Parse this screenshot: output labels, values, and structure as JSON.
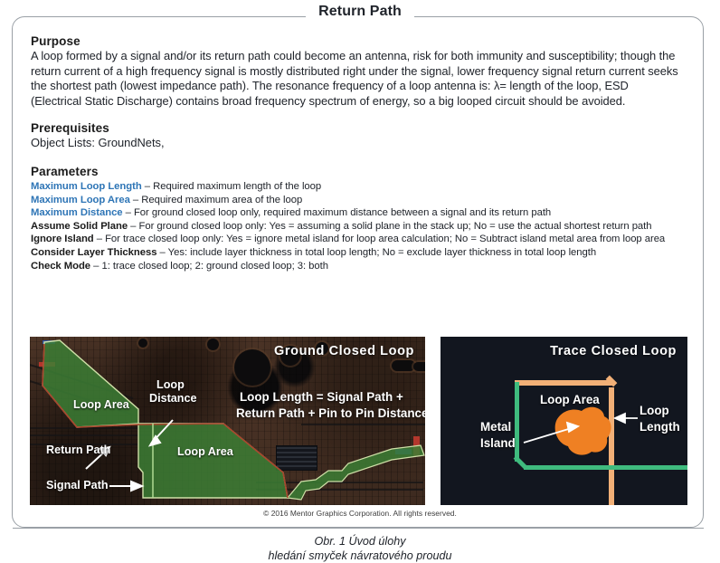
{
  "frame": {
    "title": "Return Path"
  },
  "purpose": {
    "heading": "Purpose",
    "text": "A loop formed by a signal and/or its return path could become an antenna, risk for both immunity and susceptibility; though the return current of a high frequency signal is mostly distributed right under the signal, lower frequency signal return current seeks the shortest path (lowest impedance path). The resonance frequency of a loop antenna is: λ= length of the loop, ESD (Electrical Static Discharge) contains broad frequency spectrum of energy, so a big looped circuit should be avoided."
  },
  "prerequisites": {
    "heading": "Prerequisites",
    "text": "Object Lists: GroundNets,"
  },
  "parameters": {
    "heading": "Parameters",
    "items": [
      {
        "name": "Maximum Loop Length",
        "color": "blue",
        "desc": " – Required maximum  length of the loop"
      },
      {
        "name": "Maximum Loop Area",
        "color": "blue",
        "desc": " – Required maximum  area of the loop"
      },
      {
        "name": "Maximum Distance",
        "color": "blue",
        "desc": " – For ground closed loop only, required maximum  distance between a signal and its return path"
      },
      {
        "name": "Assume Solid Plane",
        "color": "dark",
        "desc": " – For ground closed loop only: Yes = assuming a solid plane in the stack up; No = use the actual shortest return  path"
      },
      {
        "name": "Ignore Island",
        "color": "dark",
        "desc": " – For trace closed loop only: Yes = ignore metal island for loop area calculation; No = Subtract island metal area from  loop area"
      },
      {
        "name": "Consider Layer Thickness",
        "color": "dark",
        "desc": " – Yes: include layer thickness in total loop length; No = exclude layer thickness in total loop length"
      },
      {
        "name": "Check Mode",
        "color": "dark",
        "desc": " – 1: trace closed loop;  2: ground closed loop;  3: both"
      }
    ]
  },
  "figure_left": {
    "caption": "Ground  Closed  Loop",
    "labels": {
      "loop_area_1": "Loop Area",
      "loop_area_2": "Loop Area",
      "loop_distance_line1": "Loop",
      "loop_distance_line2": "Distance",
      "return_path": "Return Path",
      "signal_path": "Signal Path"
    },
    "formula_line1": "Loop Length = Signal Path +",
    "formula_line2": "Return Path + Pin to Pin Distance"
  },
  "figure_right": {
    "caption": "Trace Closed Loop",
    "labels": {
      "loop_area": "Loop Area",
      "metal_island_line1": "Metal",
      "metal_island_line2": "Island",
      "loop_length_line1": "Loop",
      "loop_length_line2": "Length"
    }
  },
  "copyright": "© 2016 Mentor Graphics Corporation. All rights reserved.",
  "caption": {
    "line1": "Obr. 1  Úvod úlohy",
    "line2": "hledání smyček návratového proudu"
  },
  "colors": {
    "accent_blue": "#2e75b6",
    "frame_border": "#9aa0a6",
    "pcb_brown": "#4a3326",
    "copper_green": "#3c7e34",
    "panel_navy": "#12161f",
    "trace_orange": "#f2b077",
    "trace_green": "#3fbb7e",
    "island_orange": "#ef8023"
  }
}
